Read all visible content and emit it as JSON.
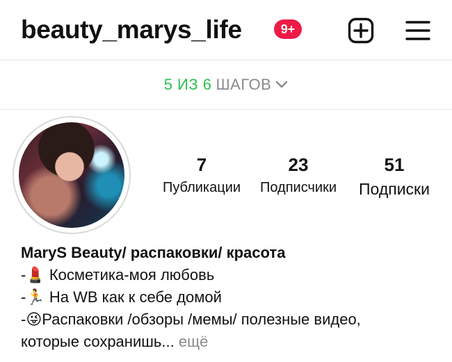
{
  "header": {
    "username": "beauty_marys_life",
    "notifications_badge": "9+",
    "badge_color": "#ef1a46",
    "add_icon": "plus-square-icon",
    "menu_icon": "hamburger-menu-icon"
  },
  "steps": {
    "done": "5 ИЗ 6",
    "rest": "ШАГОВ",
    "done_color": "#2cc04f"
  },
  "profile": {
    "avatar_alt": "profile-photo",
    "stats": [
      {
        "value": "7",
        "label": "Публикации"
      },
      {
        "value": "23",
        "label": "Подписчики"
      },
      {
        "value": "51",
        "label": "Подписки"
      }
    ]
  },
  "bio": {
    "name": "MaryS Beauty/ распаковки/ красота",
    "lines": [
      {
        "prefix": "-",
        "emoji": "💄",
        "text": "Косметика-моя любовь"
      },
      {
        "prefix": "-",
        "emoji": "🏃",
        "text": "На WB как к себе домой"
      },
      {
        "prefix": "-",
        "emoji": "😜",
        "text": "Распаковки /обзоры /мемы/ полезные видео,"
      }
    ],
    "last_line": "которые сохранишь...",
    "more": "ещё"
  }
}
